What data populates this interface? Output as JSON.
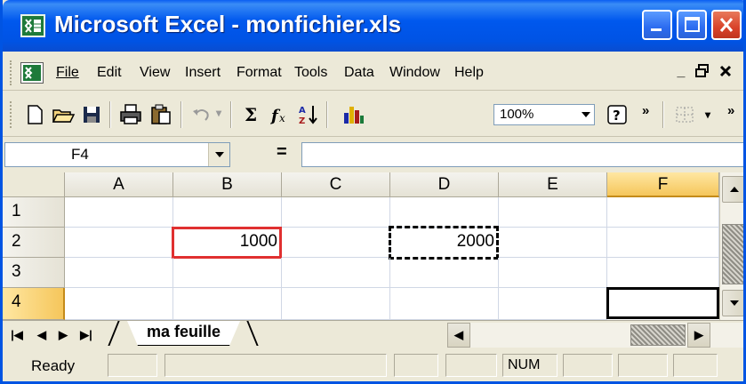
{
  "window": {
    "title": "Microsoft Excel - monfichier.xls",
    "icon": "excel-icon"
  },
  "menu": {
    "items": [
      "File",
      "Edit",
      "View",
      "Insert",
      "Format",
      "Tools",
      "Data",
      "Window",
      "Help"
    ],
    "mnemonic_index": [
      0,
      0,
      0,
      0,
      1,
      0,
      0,
      0,
      0
    ],
    "mdi_controls": [
      "_",
      "ع",
      "x"
    ]
  },
  "toolbar": {
    "zoom": "100%",
    "icons": [
      "new-icon",
      "open-icon",
      "save-icon",
      "print-icon",
      "paste-icon",
      "undo-icon",
      "autosum-icon",
      "function-icon",
      "sort-ascending-icon",
      "chart-wizard-icon",
      "zoom-dropdown",
      "help-icon",
      "toolbar-options-icon",
      "borders-icon"
    ]
  },
  "formula_bar": {
    "name_box": "F4",
    "equals": "=",
    "content": ""
  },
  "grid": {
    "columns": [
      "A",
      "B",
      "C",
      "D",
      "E",
      "F"
    ],
    "rows": [
      "1",
      "2",
      "3",
      "4"
    ],
    "active_cell": "F4",
    "cells": {
      "B2": "1000",
      "D2": "2000"
    },
    "highlight_cell": "B2",
    "copy_marquee_cell": "D2"
  },
  "sheets": {
    "tabs": [
      "ma feuille"
    ],
    "active": "ma feuille"
  },
  "status": {
    "mode": "Ready",
    "num_lock": "NUM"
  },
  "colors": {
    "title_blue": "#0054e3",
    "highlight_red": "#e03030",
    "active_header": "#f5c65b"
  }
}
